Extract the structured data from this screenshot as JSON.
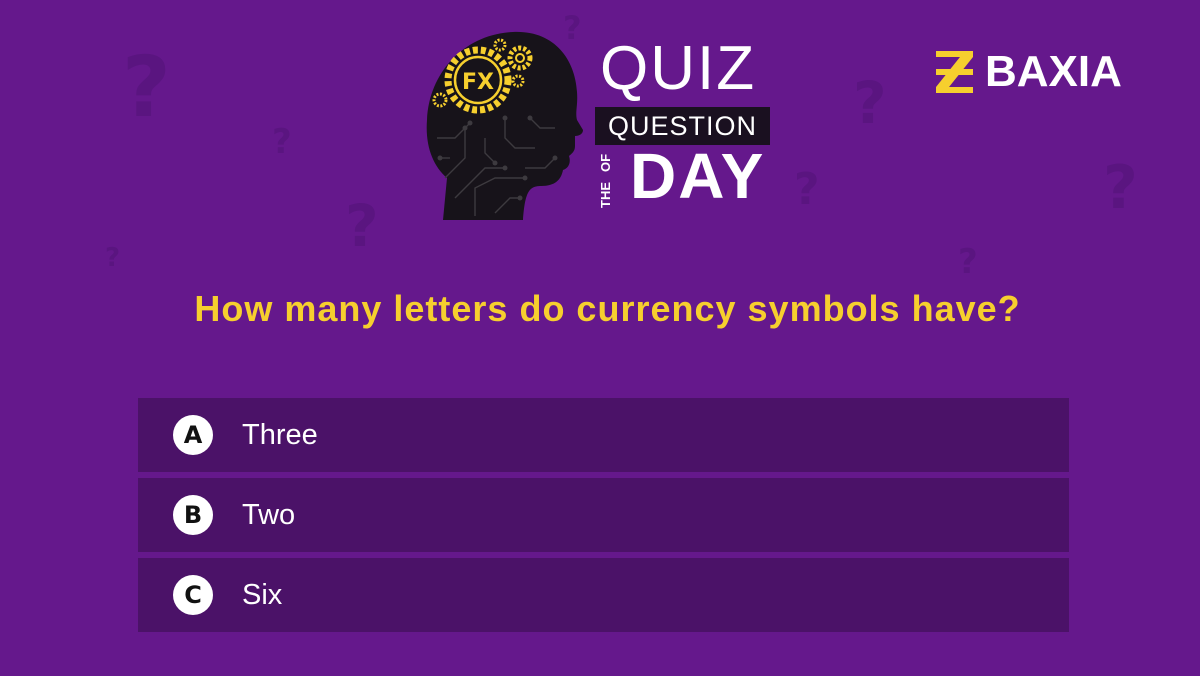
{
  "header": {
    "badge_text": "FX",
    "title_quiz": "QUIZ",
    "title_question": "QUESTION",
    "title_of": "OF",
    "title_the": "THE",
    "title_day": "DAY"
  },
  "brand": {
    "name": "BAXIA",
    "logo_color": "#f6cf2e"
  },
  "quiz": {
    "question": "How many letters do currency symbols have?",
    "answers": [
      {
        "letter": "A",
        "text": "Three"
      },
      {
        "letter": "B",
        "text": "Two"
      },
      {
        "letter": "C",
        "text": "Six"
      }
    ]
  },
  "colors": {
    "background": "#65188c",
    "answer_row": "#4b1268",
    "accent": "#f6cf2e",
    "decor_question_marks": "#5a1580"
  }
}
